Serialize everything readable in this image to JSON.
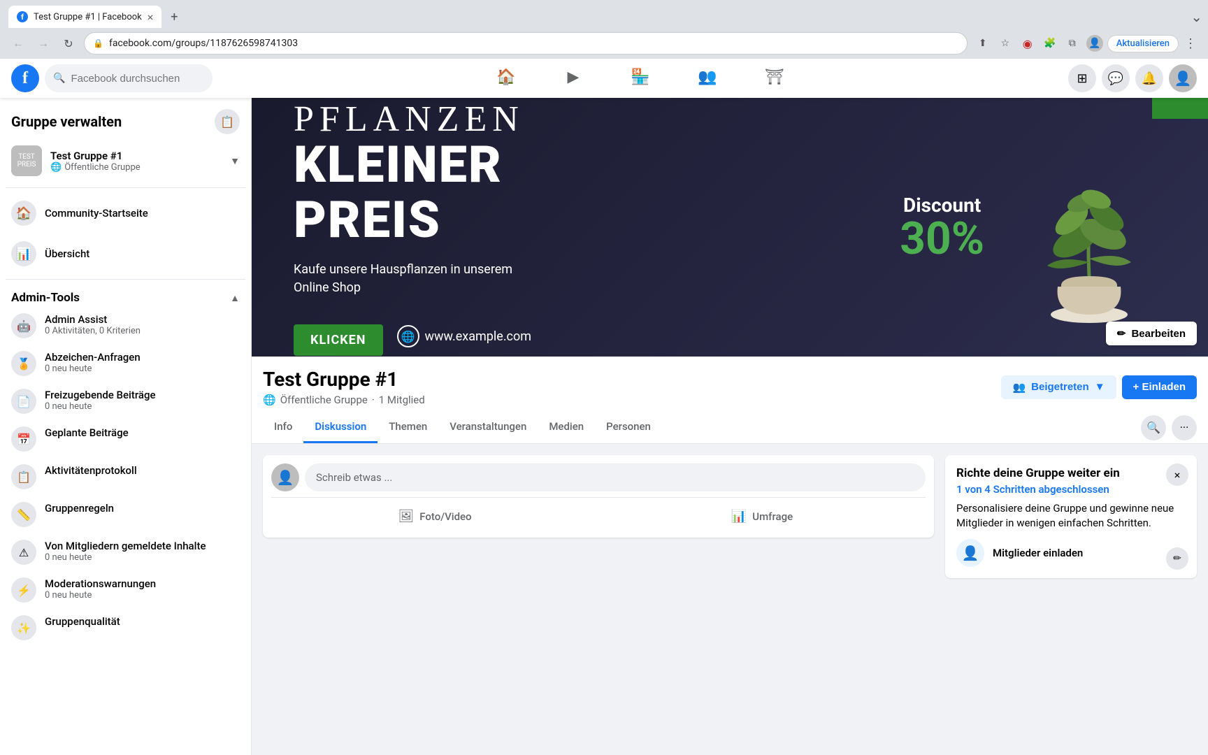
{
  "browser": {
    "tab_title": "Test Gruppe #1 | Facebook",
    "url": "facebook.com/groups/1187626598741303",
    "new_tab_icon": "+",
    "back_icon": "←",
    "forward_icon": "→",
    "refresh_icon": "↻",
    "update_btn_label": "Aktualisieren"
  },
  "header": {
    "search_placeholder": "Facebook durchsuchen",
    "nav_items": [
      {
        "icon": "🏠",
        "name": "home"
      },
      {
        "icon": "▶",
        "name": "video"
      },
      {
        "icon": "🏪",
        "name": "marketplace"
      },
      {
        "icon": "👥",
        "name": "groups"
      },
      {
        "icon": "⛩",
        "name": "gaming"
      }
    ],
    "action_icons": [
      "⊞",
      "💬",
      "🔔"
    ],
    "avatar_icon": "👤"
  },
  "sidebar": {
    "title": "Gruppe verwalten",
    "icon": "📋",
    "group": {
      "name": "Test Gruppe #1",
      "type": "Öffentliche Gruppe",
      "dropdown": "▼"
    },
    "nav": [
      {
        "icon": "🏠",
        "label": "Community-Startseite"
      },
      {
        "icon": "📊",
        "label": "Übersicht"
      }
    ],
    "admin_tools_section": "Admin-Tools",
    "admin_tools_toggle": "▲",
    "admin_tools": [
      {
        "icon": "🤖",
        "name": "Admin Assist",
        "sub": "0 Aktivitäten, 0 Kriterien"
      },
      {
        "icon": "🏅",
        "name": "Abzeichen-Anfragen",
        "sub": "0 neu heute"
      },
      {
        "icon": "📄",
        "name": "Freizugebende Beiträge",
        "sub": "0 neu heute"
      },
      {
        "icon": "📅",
        "name": "Geplante Beiträge",
        "sub": ""
      },
      {
        "icon": "📋",
        "name": "Aktivitätenprotokoll",
        "sub": ""
      },
      {
        "icon": "📏",
        "name": "Gruppenregeln",
        "sub": ""
      },
      {
        "icon": "⚠",
        "name": "Von Mitgliedern gemeldete Inhalte",
        "sub": "0 neu heute"
      },
      {
        "icon": "⚡",
        "name": "Moderationswarnungen",
        "sub": "0 neu heute"
      },
      {
        "icon": "✨",
        "name": "Gruppenqualität",
        "sub": ""
      }
    ]
  },
  "cover": {
    "pflanzen": "PFLANZEN",
    "kleiner": "KLEINER",
    "preis": "PREIS",
    "subtitle_line1": "Kaufe unsere Hauspflanzen in unserem",
    "subtitle_line2": "Online Shop",
    "klicken": "KLICKEN",
    "website": "www.example.com",
    "discount_label": "Discount",
    "discount_pct": "30%",
    "edit_btn": "Bearbeiten",
    "edit_icon": "✏"
  },
  "group_info": {
    "name": "Test Gruppe #1",
    "type": "Öffentliche Gruppe",
    "dot": "·",
    "members": "1 Mitglied",
    "globe_icon": "🌐",
    "joined_btn": "Beigetreten",
    "invite_btn": "+ Einladen",
    "tabs": [
      {
        "label": "Info",
        "active": false
      },
      {
        "label": "Diskussion",
        "active": true
      },
      {
        "label": "Themen",
        "active": false
      },
      {
        "label": "Veranstaltungen",
        "active": false
      },
      {
        "label": "Medien",
        "active": false
      },
      {
        "label": "Personen",
        "active": false
      }
    ],
    "search_icon": "🔍",
    "more_icon": "···"
  },
  "post_box": {
    "placeholder": "Schreib etwas ...",
    "photo_video_btn": "Foto/Video",
    "umfrage_btn": "Umfrage",
    "photo_icon": "🖼",
    "umfrage_icon": "📊"
  },
  "setup_card": {
    "title": "Richte deine Gruppe weiter ein",
    "progress": "1 von 4 Schritten abgeschlossen",
    "desc": "Personalisiere deine Gruppe und gewinne neue Mitglieder in wenigen einfachen Schritten.",
    "action_icon": "👤",
    "action_text": "Mitglieder einladen",
    "close_icon": "×",
    "edit_icon": "✏"
  },
  "colors": {
    "fb_blue": "#1877f2",
    "fb_bg": "#f0f2f5",
    "green": "#2d8c2d",
    "text_primary": "#050505",
    "text_secondary": "#65676b"
  }
}
